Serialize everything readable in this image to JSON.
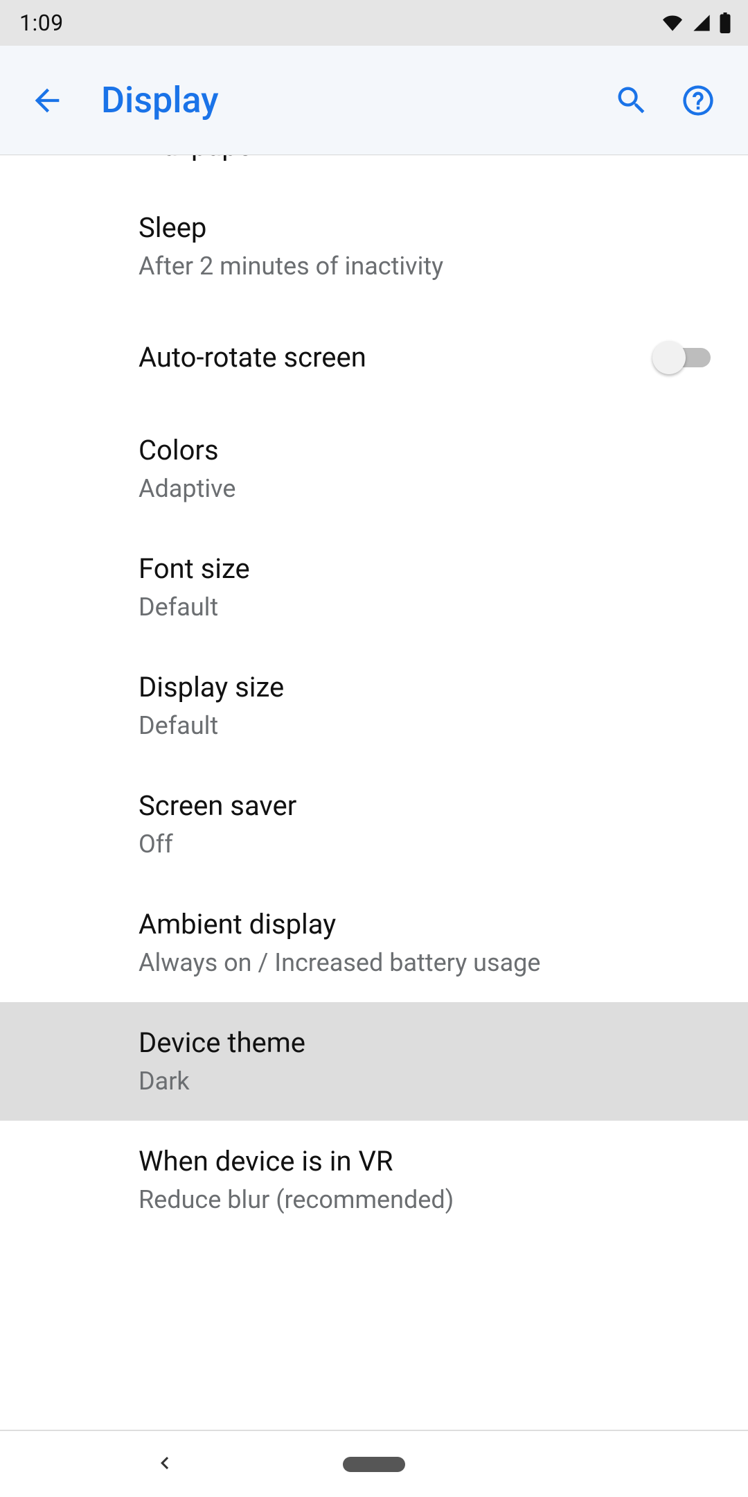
{
  "status": {
    "time": "1:09"
  },
  "appbar": {
    "title": "Display"
  },
  "items": [
    {
      "title": "Wallpaper"
    },
    {
      "title": "Sleep",
      "sub": "After 2 minutes of inactivity"
    },
    {
      "title": "Auto-rotate screen"
    },
    {
      "title": "Colors",
      "sub": "Adaptive"
    },
    {
      "title": "Font size",
      "sub": "Default"
    },
    {
      "title": "Display size",
      "sub": "Default"
    },
    {
      "title": "Screen saver",
      "sub": "Off"
    },
    {
      "title": "Ambient display",
      "sub": "Always on / Increased battery usage"
    },
    {
      "title": "Device theme",
      "sub": "Dark"
    },
    {
      "title": "When device is in VR",
      "sub": "Reduce blur (recommended)"
    }
  ]
}
